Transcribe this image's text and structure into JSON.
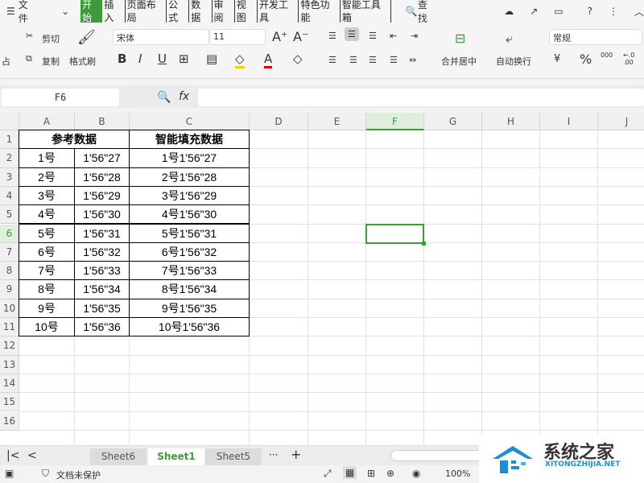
{
  "menubar": {
    "hamburger": "☰",
    "file": "文件",
    "tabs": [
      "开始",
      "插入",
      "页面布局",
      "公式",
      "数据",
      "审阅",
      "视图",
      "开发工具",
      "特色功能",
      "智能工具箱"
    ],
    "active_tab": "开始",
    "search": "查找"
  },
  "ribbon": {
    "cut": "剪切",
    "copy": "复制",
    "paste": "占",
    "format_painter": "格式刷",
    "font_name": "宋体",
    "font_size": "11",
    "bold": "B",
    "italic": "I",
    "underline": "U",
    "merge_center": "合并居中",
    "wrap_text": "自动换行",
    "number_format": "常规",
    "percent": "%",
    "thousands": "000",
    "decimal": "←.0 .00",
    "currency": "¥"
  },
  "formula_bar": {
    "name_box": "F6",
    "fx": "fx",
    "value": ""
  },
  "columns": [
    "A",
    "B",
    "C",
    "D",
    "E",
    "F",
    "G",
    "H",
    "I",
    "J"
  ],
  "active_column": "F",
  "active_row": 6,
  "rows": [
    1,
    2,
    3,
    4,
    5,
    6,
    7,
    8,
    9,
    10,
    11,
    12,
    13,
    14,
    15,
    16
  ],
  "table": {
    "header_ref": "参考数据",
    "header_fill": "智能填充数据",
    "data": [
      [
        "1号",
        "1'56\"27",
        "1号1'56\"27"
      ],
      [
        "2号",
        "1'56\"28",
        "2号1'56\"28"
      ],
      [
        "3号",
        "1'56\"29",
        "3号1'56\"29"
      ],
      [
        "4号",
        "1'56\"30",
        "4号1'56\"30"
      ],
      [
        "5号",
        "1'56\"31",
        "5号1'56\"31"
      ],
      [
        "6号",
        "1'56\"32",
        "6号1'56\"32"
      ],
      [
        "7号",
        "1'56\"33",
        "7号1'56\"33"
      ],
      [
        "8号",
        "1'56\"34",
        "8号1'56\"34"
      ],
      [
        "9号",
        "1'56\"35",
        "9号1'56\"35"
      ],
      [
        "10号",
        "1'56\"36",
        "10号1'56\"36"
      ]
    ]
  },
  "sheet_tabs": [
    "Sheet6",
    "Sheet1",
    "Sheet5"
  ],
  "active_sheet": "Sheet1",
  "more": "···",
  "add": "+",
  "status": {
    "protect": "文档未保护",
    "zoom": "100%"
  },
  "watermark": {
    "name": "系统之家",
    "url": "XITONGZHIJIA.NET"
  },
  "colors": {
    "accent": "#3d9b3a"
  }
}
